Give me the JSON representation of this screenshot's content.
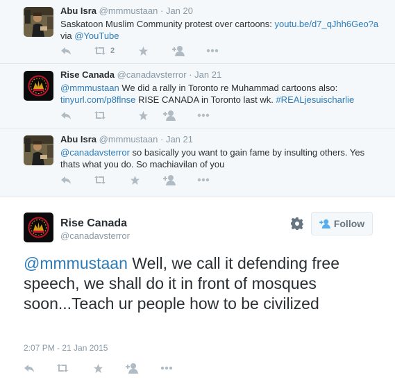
{
  "thread": [
    {
      "fullname": "Abu Isra",
      "username": "@mmmustaan",
      "time": "Jan 20",
      "text_parts": [
        "Saskatoon Muslim Community protest over cartoons: ",
        "youtu.be/d7_qJhh6Geo?a",
        "via ",
        "@YouTube"
      ],
      "retweet_count": "2"
    },
    {
      "fullname": "Rise Canada",
      "username": "@canadavsterror",
      "time": "Jan 21",
      "text_parts": [
        "@mmmustaan",
        " We did a rally in Toronto re Muhammad cartoons also:",
        "tinyurl.com/p8flnse",
        " RISE CANADA in Toronto last wk. ",
        "#REALjesuischarlie"
      ]
    },
    {
      "fullname": "Abu Isra",
      "username": "@mmmustaan",
      "time": "Jan 21",
      "text_parts": [
        "@canadavsterror",
        " so basically you want to gain fame by insulting others. Yes",
        "thats what you do. So machiavilan of you"
      ]
    }
  ],
  "main": {
    "fullname": "Rise Canada",
    "username": "@canadavsterror",
    "follow_label": "Follow",
    "mention": "@mmmustaan",
    "text": " Well, we call it defending free speech, we shall do it in front of mosques soon...Teach ur people how to be civilized",
    "date": "2:07 PM - 21 Jan 2015"
  },
  "colors": {
    "link": "#2b7bb9",
    "muted": "#8899a6",
    "thread_bg": "#f5f8fa",
    "follow_icon": "#55acee"
  },
  "icons": [
    "reply-icon",
    "retweet-icon",
    "favorite-icon",
    "follow-user-icon",
    "more-icon",
    "gear-icon"
  ]
}
